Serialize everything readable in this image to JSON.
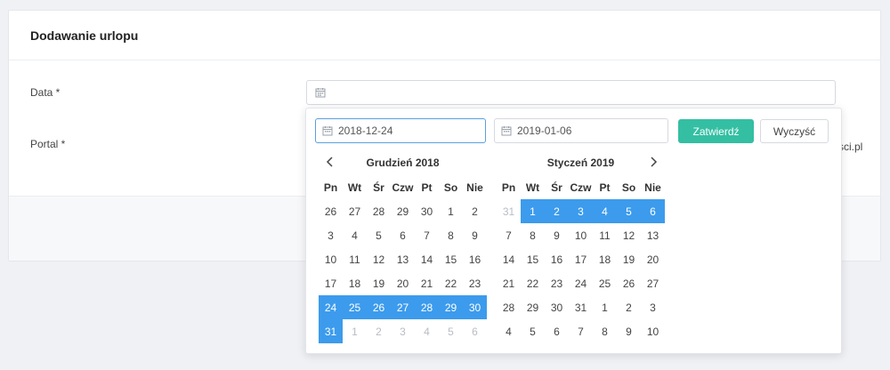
{
  "card": {
    "title": "Dodawanie urlopu"
  },
  "form": {
    "date_label": "Data *",
    "portal_label": "Portal *",
    "portal_value_visible": "sci.pl"
  },
  "picker": {
    "start_date": "2018-12-24",
    "end_date": "2019-01-06",
    "confirm_label": "Zatwierdź",
    "clear_label": "Wyczyść",
    "prev_icon": "chevron-left-icon",
    "next_icon": "chevron-right-icon",
    "weekdays": [
      "Pn",
      "Wt",
      "Śr",
      "Czw",
      "Pt",
      "So",
      "Nie"
    ],
    "months": [
      {
        "title": "Grudzień 2018",
        "weeks": [
          [
            {
              "d": "26"
            },
            {
              "d": "27"
            },
            {
              "d": "28"
            },
            {
              "d": "29"
            },
            {
              "d": "30"
            },
            {
              "d": "1"
            },
            {
              "d": "2"
            }
          ],
          [
            {
              "d": "3"
            },
            {
              "d": "4"
            },
            {
              "d": "5"
            },
            {
              "d": "6"
            },
            {
              "d": "7"
            },
            {
              "d": "8"
            },
            {
              "d": "9"
            }
          ],
          [
            {
              "d": "10"
            },
            {
              "d": "11"
            },
            {
              "d": "12"
            },
            {
              "d": "13"
            },
            {
              "d": "14"
            },
            {
              "d": "15"
            },
            {
              "d": "16"
            }
          ],
          [
            {
              "d": "17"
            },
            {
              "d": "18"
            },
            {
              "d": "19"
            },
            {
              "d": "20"
            },
            {
              "d": "21"
            },
            {
              "d": "22"
            },
            {
              "d": "23"
            }
          ],
          [
            {
              "d": "24",
              "sel": true
            },
            {
              "d": "25",
              "sel": true
            },
            {
              "d": "26",
              "sel": true
            },
            {
              "d": "27",
              "sel": true
            },
            {
              "d": "28",
              "sel": true
            },
            {
              "d": "29",
              "sel": true
            },
            {
              "d": "30",
              "sel": true
            }
          ],
          [
            {
              "d": "31",
              "sel": true
            },
            {
              "d": "1",
              "off": true
            },
            {
              "d": "2",
              "off": true
            },
            {
              "d": "3",
              "off": true
            },
            {
              "d": "4",
              "off": true
            },
            {
              "d": "5",
              "off": true
            },
            {
              "d": "6",
              "off": true
            }
          ]
        ]
      },
      {
        "title": "Styczeń 2019",
        "weeks": [
          [
            {
              "d": "31",
              "off": true
            },
            {
              "d": "1",
              "sel": true
            },
            {
              "d": "2",
              "sel": true
            },
            {
              "d": "3",
              "sel": true
            },
            {
              "d": "4",
              "sel": true
            },
            {
              "d": "5",
              "sel": true
            },
            {
              "d": "6",
              "sel": true
            }
          ],
          [
            {
              "d": "7"
            },
            {
              "d": "8"
            },
            {
              "d": "9"
            },
            {
              "d": "10"
            },
            {
              "d": "11"
            },
            {
              "d": "12"
            },
            {
              "d": "13"
            }
          ],
          [
            {
              "d": "14"
            },
            {
              "d": "15"
            },
            {
              "d": "16"
            },
            {
              "d": "17"
            },
            {
              "d": "18"
            },
            {
              "d": "19"
            },
            {
              "d": "20"
            }
          ],
          [
            {
              "d": "21"
            },
            {
              "d": "22"
            },
            {
              "d": "23"
            },
            {
              "d": "24"
            },
            {
              "d": "25"
            },
            {
              "d": "26"
            },
            {
              "d": "27"
            }
          ],
          [
            {
              "d": "28"
            },
            {
              "d": "29"
            },
            {
              "d": "30"
            },
            {
              "d": "31"
            },
            {
              "d": "1"
            },
            {
              "d": "2"
            },
            {
              "d": "3"
            }
          ],
          [
            {
              "d": "4"
            },
            {
              "d": "5"
            },
            {
              "d": "6"
            },
            {
              "d": "7"
            },
            {
              "d": "8"
            },
            {
              "d": "9"
            },
            {
              "d": "10"
            }
          ]
        ]
      }
    ]
  },
  "colors": {
    "accent": "#34bfa3",
    "selected": "#3c9bec",
    "active_border": "#5b9fe0"
  }
}
